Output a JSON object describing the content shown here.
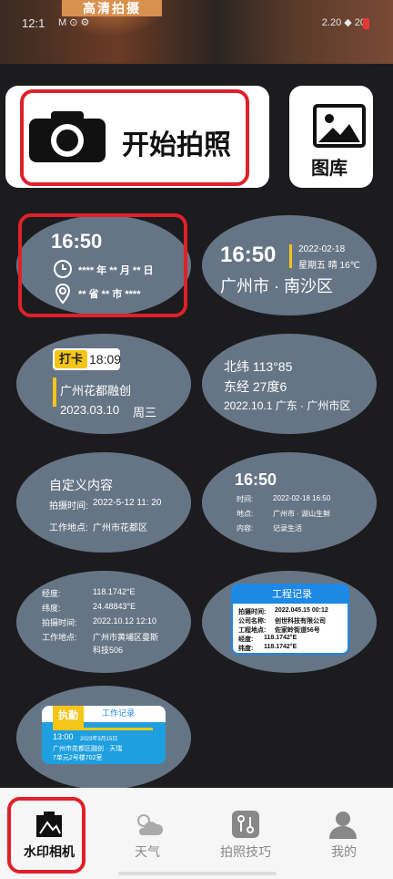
{
  "header": {
    "banner": "高清拍摄",
    "status_time": "12:1",
    "status_icons": "M  ⊙ ⚙",
    "status_right": "2.20  ◆ 20"
  },
  "top": {
    "start_label": "开始拍照",
    "gallery_label": "图库"
  },
  "templates": {
    "t1": {
      "time": "16:50",
      "date": "**** 年 ** 月 ** 日",
      "location": "** 省 ** 市 ****"
    },
    "t2": {
      "time": "16:50",
      "date": "2022-02-18",
      "weather": "星期五 晴 16℃",
      "place": "广州市 · 南沙区"
    },
    "t3": {
      "badge": "打卡",
      "time": "18:09",
      "place": "广州花都融创",
      "date": "2023.03.10",
      "weekday": "周三"
    },
    "t4": {
      "lat": "北纬 113°85",
      "lon": "东经 27度6",
      "line3": "2022.10.1  广东 · 广州市区"
    },
    "t5": {
      "title": "自定义内容",
      "shot_label": "拍摄时间:",
      "shot_value": "2022-5-12 11: 20",
      "work_label": "工作地点:",
      "work_value": "广州市花都区"
    },
    "t6": {
      "time": "16:50",
      "row1_label": "时间:",
      "row1_value": "2022-02-18   16:50",
      "row2_label": "地点:",
      "row2_value": "广州市 · 湖山生鲜",
      "row3_label": "内容:",
      "row3_value": "记录生活"
    },
    "t7": {
      "rows": [
        {
          "label": "经度:",
          "value": "118.1742°E"
        },
        {
          "label": "纬度:",
          "value": "24.48843°E"
        },
        {
          "label": "拍摄时间:",
          "value": "2022.10.12 12:10"
        },
        {
          "label": "工作地点:",
          "value": "广州市黄埔区曼斯"
        },
        {
          "label": "",
          "value": "科技506"
        }
      ]
    },
    "t8": {
      "title": "工程记录",
      "rows": [
        {
          "label": "拍摄时间:",
          "value": "2022.045.15 00:12"
        },
        {
          "label": "公司名称:",
          "value": "创世科技有限公司"
        },
        {
          "label": "工程地点:",
          "value": "佐家岭街道56号"
        },
        {
          "label": "经度:",
          "value": "118.1742°E"
        },
        {
          "label": "纬度:",
          "value": "118.1742°E"
        }
      ]
    },
    "t9": {
      "badge": "执勤",
      "title": "工作记录",
      "time": "13:00",
      "date": "2023年3月15日",
      "line1": "广州市花都区融创 · 天瑞",
      "line2": "7单元2号楼702室"
    }
  },
  "nav": {
    "items": [
      {
        "label": "水印相机",
        "icon": "watermark-camera-icon"
      },
      {
        "label": "天气",
        "icon": "weather-icon"
      },
      {
        "label": "拍照技巧",
        "icon": "tips-icon"
      },
      {
        "label": "我的",
        "icon": "profile-icon"
      }
    ]
  },
  "colors": {
    "highlight": "#e0202a",
    "oval": "#667586",
    "accent_yellow": "#f5c518",
    "accent_blue": "#1e88e5"
  }
}
